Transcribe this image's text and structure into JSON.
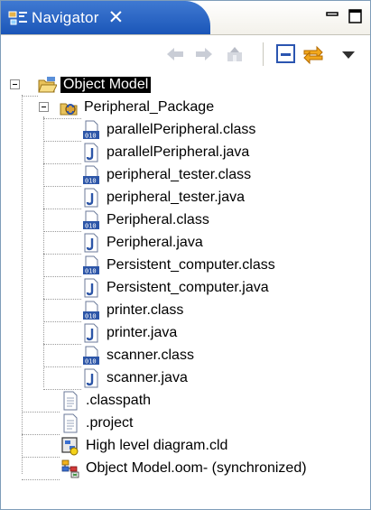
{
  "view": {
    "title": "Navigator",
    "close_glyph": "✕"
  },
  "toolbar": {
    "buttons": [
      "back-arrow-icon",
      "forward-arrow-icon",
      "go-up-icon",
      "collapse-all-icon",
      "link-with-editor-icon",
      "view-menu-icon"
    ]
  },
  "tree": {
    "root": {
      "label": "Object Model",
      "selected": true,
      "icon": "open-project-folder-icon"
    },
    "package": {
      "label": "Peripheral_Package",
      "icon": "package-icon"
    },
    "files": [
      {
        "label": "parallelPeripheral.class",
        "icon": "class-file-icon"
      },
      {
        "label": "parallelPeripheral.java",
        "icon": "java-file-icon"
      },
      {
        "label": "peripheral_tester.class",
        "icon": "class-file-icon"
      },
      {
        "label": "peripheral_tester.java",
        "icon": "java-file-icon"
      },
      {
        "label": "Peripheral.class",
        "icon": "class-file-icon"
      },
      {
        "label": "Peripheral.java",
        "icon": "java-file-icon"
      },
      {
        "label": "Persistent_computer.class",
        "icon": "class-file-icon"
      },
      {
        "label": "Persistent_computer.java",
        "icon": "java-file-icon"
      },
      {
        "label": "printer.class",
        "icon": "class-file-icon"
      },
      {
        "label": "printer.java",
        "icon": "java-file-icon"
      },
      {
        "label": "scanner.class",
        "icon": "class-file-icon"
      },
      {
        "label": "scanner.java",
        "icon": "java-file-icon"
      }
    ],
    "root_files": [
      {
        "label": ".classpath",
        "icon": "text-file-icon"
      },
      {
        "label": ".project",
        "icon": "text-file-icon"
      },
      {
        "label": "High level diagram.cld",
        "icon": "diagram-file-icon"
      },
      {
        "label": "Object Model.oom- (synchronized)",
        "icon": "object-model-file-icon"
      }
    ]
  },
  "colors": {
    "tab_active": "#1b56b8",
    "selection_bg": "#000000",
    "tree_lines": "#9b9b9b"
  }
}
